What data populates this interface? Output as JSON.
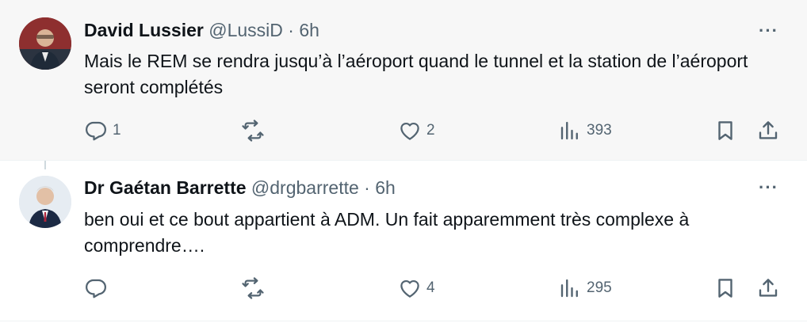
{
  "tweets": [
    {
      "name": "David Lussier",
      "handle": "@LussiD",
      "separator": "·",
      "time": "6h",
      "more": "···",
      "text": "Mais le REM se rendra jusqu’à l’aéroport quand le tunnel et la station de l’aéroport seront complétés",
      "reply_count": "1",
      "retweet_count": "",
      "like_count": "2",
      "view_count": "393"
    },
    {
      "name": "Dr Gaétan Barrette",
      "handle": "@drgbarrette",
      "separator": "·",
      "time": "6h",
      "more": "···",
      "text": "ben oui et ce bout appartient à ADM. Un fait apparemment très complexe à comprendre….",
      "reply_count": "",
      "retweet_count": "",
      "like_count": "4",
      "view_count": "295"
    }
  ],
  "icons": {
    "reply": "reply-icon",
    "retweet": "retweet-icon",
    "like": "heart-icon",
    "views": "views-icon",
    "bookmark": "bookmark-icon",
    "share": "share-icon"
  },
  "colors": {
    "text": "#0f1419",
    "muted": "#536471",
    "thread_line": "#cfd9de",
    "highlight_bg": "#f7f7f7"
  }
}
